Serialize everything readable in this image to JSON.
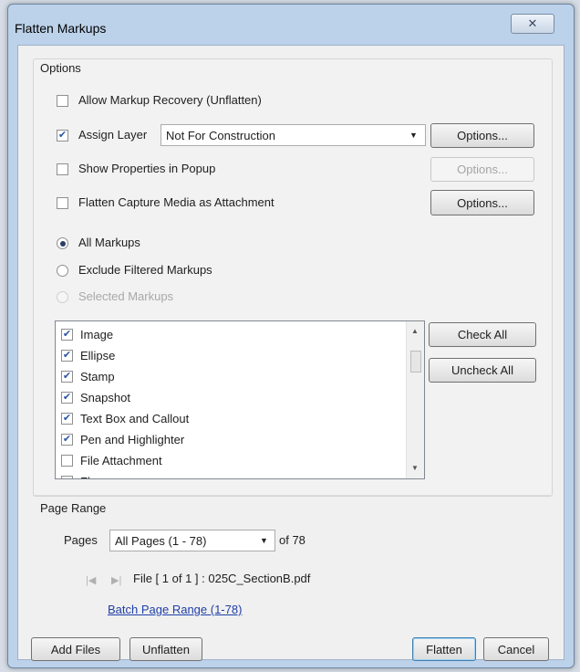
{
  "window": {
    "title": "Flatten Markups",
    "close_glyph": "✕"
  },
  "options": {
    "group_label": "Options",
    "allow_recovery": {
      "label": "Allow Markup Recovery (Unflatten)",
      "checked": false
    },
    "assign_layer": {
      "label": "Assign Layer",
      "checked": true,
      "value": "Not For Construction",
      "options_label": "Options..."
    },
    "show_properties": {
      "label": "Show Properties in Popup",
      "checked": false,
      "options_label": "Options..."
    },
    "flatten_capture": {
      "label": "Flatten Capture Media as Attachment",
      "checked": false,
      "options_label": "Options..."
    },
    "radios": [
      {
        "label": "All Markups",
        "selected": true,
        "disabled": false
      },
      {
        "label": "Exclude Filtered Markups",
        "selected": false,
        "disabled": false
      },
      {
        "label": "Selected Markups",
        "selected": false,
        "disabled": true
      }
    ],
    "markup_types": [
      {
        "label": "Image",
        "checked": true
      },
      {
        "label": "Ellipse",
        "checked": true
      },
      {
        "label": "Stamp",
        "checked": true
      },
      {
        "label": "Snapshot",
        "checked": true
      },
      {
        "label": "Text Box and Callout",
        "checked": true
      },
      {
        "label": "Pen and Highlighter",
        "checked": true
      },
      {
        "label": "File Attachment",
        "checked": false
      },
      {
        "label": "Flag",
        "checked": false
      }
    ],
    "check_all_label": "Check All",
    "uncheck_all_label": "Uncheck All"
  },
  "page_range": {
    "group_label": "Page Range",
    "pages_label": "Pages",
    "pages_value": "All Pages (1 - 78)",
    "of_label": "of 78",
    "file_label": "File [ 1 of 1 ] :  025C_SectionB.pdf",
    "batch_link": "Batch Page Range (1-78)"
  },
  "footer": {
    "add_files": "Add Files",
    "unflatten": "Unflatten",
    "flatten": "Flatten",
    "cancel": "Cancel"
  }
}
